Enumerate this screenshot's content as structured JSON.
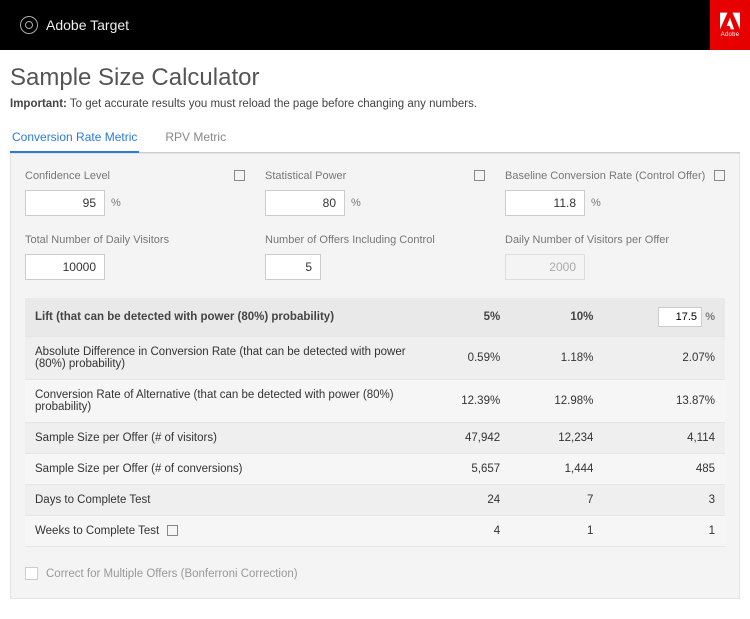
{
  "header": {
    "brand": "Adobe Target",
    "adobe": "Adobe"
  },
  "page": {
    "title": "Sample Size Calculator",
    "note_strong": "Important:",
    "note_rest": " To get accurate results you must reload the page before changing any numbers."
  },
  "tabs": {
    "conversion": "Conversion Rate Metric",
    "rpv": "RPV Metric"
  },
  "fields": {
    "confidence_label": "Confidence Level",
    "confidence_value": "95",
    "power_label": "Statistical Power",
    "power_value": "80",
    "baseline_label": "Baseline Conversion Rate (Control Offer)",
    "baseline_value": "11.8",
    "visitors_label": "Total Number of Daily Visitors",
    "visitors_value": "10000",
    "offers_label": "Number of Offers Including Control",
    "offers_value": "5",
    "perOffer_label": "Daily Number of Visitors per Offer",
    "perOffer_value": "2000",
    "percent": "%"
  },
  "table": {
    "head": {
      "lift": "Lift (that can be detected with power (80%) probability)",
      "c1": "5%",
      "c2": "10%",
      "c3_value": "17.5",
      "c3_unit": "%"
    },
    "rows": [
      {
        "label": "Absolute Difference in Conversion Rate (that can be detected with power (80%) probability)",
        "c1": "0.59%",
        "c2": "1.18%",
        "c3": "2.07%",
        "lock": false
      },
      {
        "label": "Conversion Rate of Alternative (that can be detected with power (80%) probability)",
        "c1": "12.39%",
        "c2": "12.98%",
        "c3": "13.87%",
        "lock": false
      },
      {
        "label": "Sample Size per Offer (# of visitors)",
        "c1": "47,942",
        "c2": "12,234",
        "c3": "4,114",
        "lock": false
      },
      {
        "label": "Sample Size per Offer (# of conversions)",
        "c1": "5,657",
        "c2": "1,444",
        "c3": "485",
        "lock": false
      },
      {
        "label": "Days to Complete Test",
        "c1": "24",
        "c2": "7",
        "c3": "3",
        "lock": false
      },
      {
        "label": "Weeks to Complete Test",
        "c1": "4",
        "c2": "1",
        "c3": "1",
        "lock": true
      }
    ]
  },
  "footer": {
    "bonferroni": "Correct for Multiple Offers (Bonferroni Correction)"
  }
}
